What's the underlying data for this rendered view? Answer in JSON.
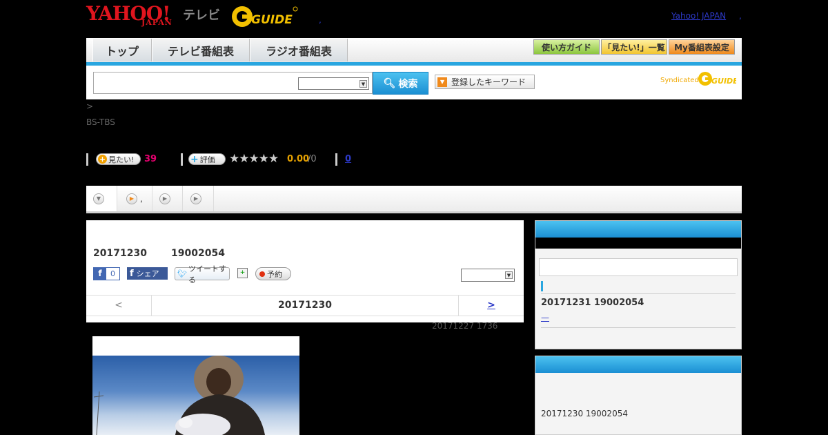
{
  "header": {
    "yahoo_logo": "YAHOO!",
    "japan_logo": "JAPAN",
    "tv_label": "テレビ",
    "gguide_logo": "G-GUIDE",
    "top_link": "Yahoo! JAPAN",
    "top_dot": ",",
    "mid_dot": ","
  },
  "nav": {
    "tabs": [
      "トップ",
      "テレビ番組表",
      "ラジオ番組表"
    ],
    "buttons": [
      "使い方ガイド",
      "「見たい!」一覧",
      "My番組表設定"
    ]
  },
  "search": {
    "input_value": "",
    "select_value": "",
    "search_label": "検索",
    "keyword_label": "登録したキーワード",
    "syndicated_label": "Syndicated"
  },
  "breadcrumb": ">",
  "channel": "BS-TBS",
  "stats": {
    "mitai_label": "見たい!",
    "mitai_count": "39",
    "hyoka_label": "評価",
    "stars": "★★★★★",
    "rating": "0.00",
    "rating_total": "/0",
    "review_count": "0"
  },
  "subtabs": [
    "",
    ",",
    "",
    ""
  ],
  "program": {
    "date": "20171230",
    "time": "19002054",
    "fb_like_count": "0",
    "fb_share_label": "シェア",
    "tweet_label": "ツイートする",
    "record_label": "予約",
    "panel_select_value": "",
    "prev_label": "<",
    "current_date": "20171230",
    "next_label": ">",
    "updated": "20171227  1736"
  },
  "sidebar": {
    "input_value": "",
    "item": "20171231  19002054",
    "item_link": "—",
    "item2": "20171230  19002054"
  },
  "colors": {
    "accent_blue": "#29a6e0",
    "yahoo_red": "#e0151e",
    "pink": "#e4006e",
    "link": "#2c39c8"
  }
}
